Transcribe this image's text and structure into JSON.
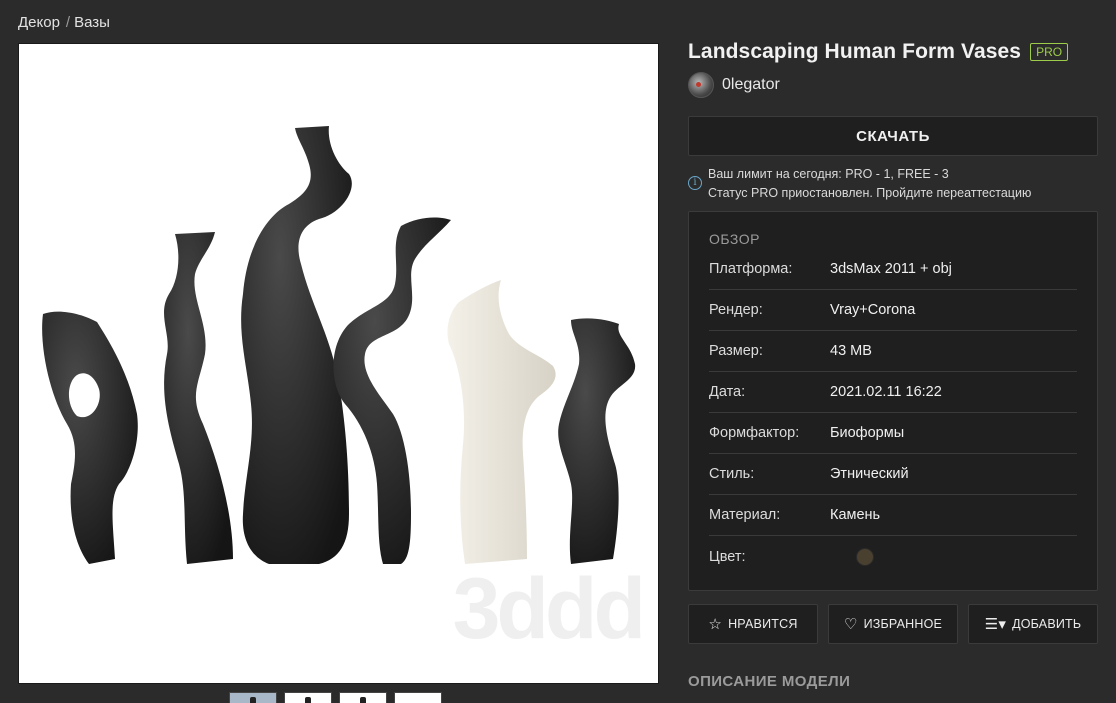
{
  "breadcrumb": {
    "items": [
      "Декор",
      "Вазы"
    ],
    "separator": "/"
  },
  "preview": {
    "watermark": "3ddd"
  },
  "product": {
    "title": "Landscaping Human Form Vases",
    "badge": "PRO",
    "author": "0legator"
  },
  "download": {
    "label": "СКАЧАТЬ"
  },
  "limit": {
    "line1": "Ваш лимит на сегодня: PRO - 1, FREE - 3",
    "line2": "Статус PRO приостановлен. Пройдите переаттестацию"
  },
  "overview": {
    "title": "ОБЗОР",
    "rows": [
      {
        "label": "Платформа:",
        "value": "3dsMax 2011 + obj"
      },
      {
        "label": "Рендер:",
        "value": "Vray+Corona"
      },
      {
        "label": "Размер:",
        "value": "43 MB"
      },
      {
        "label": "Дата:",
        "value": "2021.02.11 16:22"
      },
      {
        "label": "Формфактор:",
        "value": "Биоформы"
      },
      {
        "label": "Стиль:",
        "value": "Этнический"
      },
      {
        "label": "Материал:",
        "value": "Камень"
      },
      {
        "label": "Цвет:",
        "value": ""
      }
    ],
    "swatch_color": "#4a4030"
  },
  "actions": {
    "like": "НРАВИТСЯ",
    "favorite": "ИЗБРАННОЕ",
    "add": "ДОБАВИТЬ"
  },
  "description": {
    "title": "ОПИСАНИЕ МОДЕЛИ"
  },
  "colors": {
    "background": "#2b2b2b",
    "panel": "#1f1f1f",
    "pro": "#9ccc4a"
  }
}
